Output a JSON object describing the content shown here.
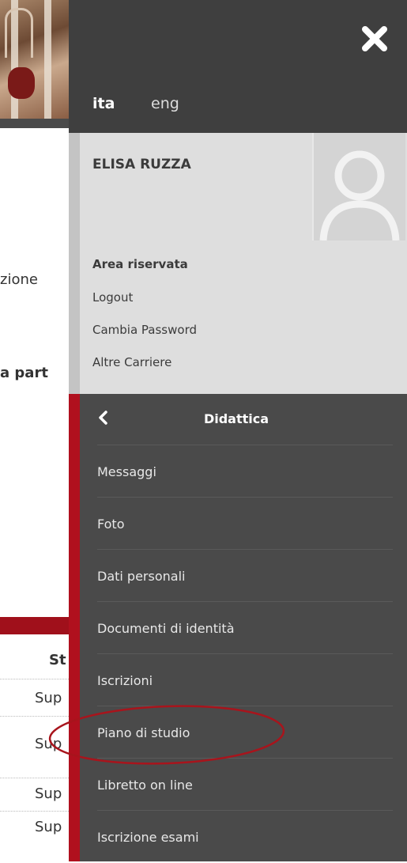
{
  "background_page": {
    "fragments": [
      "zione",
      "a part"
    ],
    "table_header": "St",
    "table_cells": [
      "Sup",
      "Sup",
      "Sup",
      "Sup"
    ]
  },
  "panel": {
    "close_icon": "close-icon",
    "languages": [
      {
        "label": "ita",
        "active": true
      },
      {
        "label": "eng",
        "active": false
      }
    ],
    "user": {
      "name": "ELISA RUZZA",
      "avatar_icon": "user-avatar-placeholder",
      "area_title": "Area riservata",
      "links": [
        "Logout",
        "Cambia Password",
        "Altre Carriere"
      ]
    },
    "menu": {
      "back_icon": "chevron-left-icon",
      "title": "Didattica",
      "items": [
        "Messaggi",
        "Foto",
        "Dati personali",
        "Documenti di identità",
        "Iscrizioni",
        "Piano di studio",
        "Libretto on line",
        "Iscrizione esami"
      ],
      "highlighted_item": "Piano di studio"
    }
  },
  "colors": {
    "panel_dark": "#3f3f3f",
    "menu_dark": "#4a4a4a",
    "user_box": "#dedede",
    "accent_red": "#b0101e",
    "annotation_ellipse": "#a8141c"
  }
}
